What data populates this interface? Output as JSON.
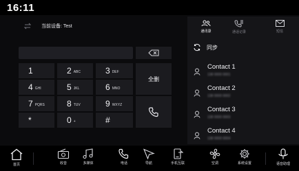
{
  "status": {
    "time": "16:11"
  },
  "device": {
    "label": "当前设备: Test"
  },
  "dialpad": {
    "keys": [
      {
        "digit": "1",
        "letters": ""
      },
      {
        "digit": "2",
        "letters": "ABC"
      },
      {
        "digit": "3",
        "letters": "DEF"
      },
      {
        "digit": "4",
        "letters": "GHI"
      },
      {
        "digit": "5",
        "letters": "JKL"
      },
      {
        "digit": "6",
        "letters": "MNO"
      },
      {
        "digit": "7",
        "letters": "PQRS"
      },
      {
        "digit": "8",
        "letters": "TUV"
      },
      {
        "digit": "9",
        "letters": "WXYZ"
      },
      {
        "digit": "*",
        "letters": ""
      },
      {
        "digit": "0",
        "letters": "+"
      },
      {
        "digit": "#",
        "letters": ""
      }
    ],
    "clear_all_label": "全删"
  },
  "tabs": [
    {
      "label": "通讯录",
      "active": true
    },
    {
      "label": "通话记录",
      "active": false
    },
    {
      "label": "短信",
      "active": false
    }
  ],
  "sync": {
    "label": "同步"
  },
  "contacts": [
    {
      "name": "Contact 1",
      "number": "138 0000 0001"
    },
    {
      "name": "Contact 2",
      "number": "138 0000 0002"
    },
    {
      "name": "Contact 3",
      "number": "138 0000 0003"
    },
    {
      "name": "Contact 4",
      "number": "138 0000 0004"
    }
  ],
  "dock": [
    {
      "label": "首页",
      "icon": "home-icon"
    },
    {
      "label": "收音",
      "icon": "radio-icon"
    },
    {
      "label": "多媒体",
      "icon": "music-icon"
    },
    {
      "label": "电话",
      "icon": "phone-icon"
    },
    {
      "label": "导航",
      "icon": "navigation-icon"
    },
    {
      "label": "手机互联",
      "icon": "phone-link-icon"
    },
    {
      "label": "空调",
      "icon": "fan-icon"
    },
    {
      "label": "系统设置",
      "icon": "settings-icon"
    },
    {
      "label": "语音助理",
      "icon": "microphone-icon"
    }
  ]
}
